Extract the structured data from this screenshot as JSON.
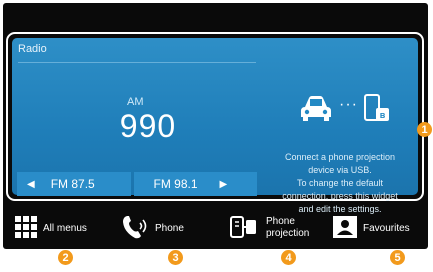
{
  "radio": {
    "title": "Radio",
    "band": "AM",
    "frequency": "990",
    "presets": [
      {
        "label": "FM 87.5"
      },
      {
        "label": "FM 98.1"
      }
    ]
  },
  "connection": {
    "message_lines": [
      "Connect a phone projection",
      "device via USB.",
      "To change the default",
      "connection, press this widget",
      "and edit the settings."
    ]
  },
  "bottom_menu": {
    "items": [
      {
        "label": "All menus",
        "icon": "grid-icon"
      },
      {
        "label": "Phone",
        "icon": "phone-handset-icon"
      },
      {
        "label_line1": "Phone",
        "label_line2": "projection",
        "icon": "phone-projection-icon"
      },
      {
        "label": "Favourites",
        "icon": "favourites-person-icon"
      }
    ]
  },
  "callouts": [
    "1",
    "2",
    "3",
    "4",
    "5"
  ],
  "colors": {
    "widget_blue": "#2389c4",
    "callout_orange": "#f29a1c",
    "background": "#0a0a0a"
  }
}
